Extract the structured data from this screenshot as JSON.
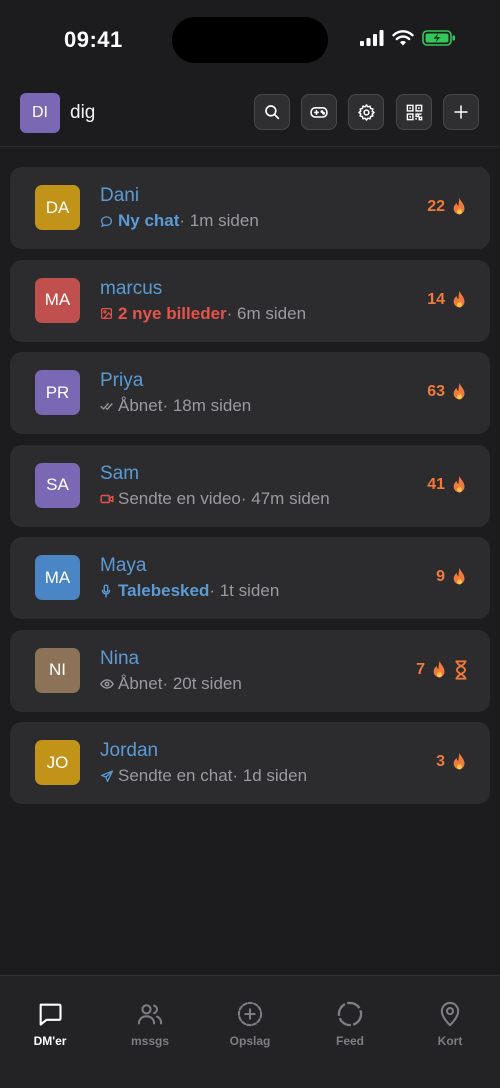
{
  "status_bar": {
    "time": "09:41"
  },
  "header": {
    "avatar_initials": "DI",
    "username": "dig",
    "buttons": [
      "search-icon",
      "gamepad-icon",
      "gear-icon",
      "qr-code-icon",
      "plus-icon"
    ]
  },
  "colors": {
    "name_blue": "#5b9bd5",
    "streak_orange": "#f07a3c",
    "unread_red": "#e5534b",
    "unread_blue": "#5b9bd5",
    "muted": "#9a9a9f"
  },
  "chats": [
    {
      "initials": "DA",
      "name": "Dani",
      "avatar_color": "#c19319",
      "status_icon": "chat-bubble-icon",
      "status_label": "Ny chat",
      "status_color": "#5b9bd5",
      "status_bold": true,
      "time": " · 1m siden",
      "streak": "22",
      "hourglass": false
    },
    {
      "initials": "MA",
      "name": "marcus",
      "avatar_color": "#c0504d",
      "status_icon": "image-icon",
      "status_label": "2 nye billeder",
      "status_color": "#e5534b",
      "status_bold": true,
      "time": " · 6m siden",
      "streak": "14",
      "hourglass": false
    },
    {
      "initials": "PR",
      "name": "Priya",
      "avatar_color": "#7b68b5",
      "status_icon": "double-check-icon",
      "status_label": "Åbnet",
      "status_color": "#9a9a9f",
      "status_bold": false,
      "time": " · 18m siden",
      "streak": "63",
      "hourglass": false
    },
    {
      "initials": "SA",
      "name": "Sam",
      "avatar_color": "#7b68b5",
      "status_icon": "video-icon",
      "status_label": "Sendte en video",
      "status_color": "#9a9a9f",
      "status_bold": false,
      "time": " · 47m siden",
      "streak": "41",
      "hourglass": false
    },
    {
      "initials": "MA",
      "name": "Maya",
      "avatar_color": "#4a86c5",
      "status_icon": "microphone-icon",
      "status_label": "Talebesked",
      "status_color": "#5b9bd5",
      "status_bold": true,
      "time": " · 1t siden",
      "streak": "9",
      "hourglass": false
    },
    {
      "initials": "NI",
      "name": "Nina",
      "avatar_color": "#8c7358",
      "status_icon": "eye-icon",
      "status_label": "Åbnet",
      "status_color": "#9a9a9f",
      "status_bold": false,
      "time": " · 20t siden",
      "streak": "7",
      "hourglass": true
    },
    {
      "initials": "JO",
      "name": "Jordan",
      "avatar_color": "#c19319",
      "status_icon": "send-arrow-icon",
      "status_label": "Sendte en chat",
      "status_color": "#9a9a9f",
      "status_bold": false,
      "time": " · 1d siden",
      "streak": "3",
      "hourglass": false
    }
  ],
  "tabs": [
    {
      "label": "DM'er",
      "icon": "chat-bubble-icon",
      "active": true
    },
    {
      "label": "mssgs",
      "icon": "users-icon",
      "active": false
    },
    {
      "label": "Opslag",
      "icon": "plus-circle-icon",
      "active": false
    },
    {
      "label": "Feed",
      "icon": "circle-icon",
      "active": false
    },
    {
      "label": "Kort",
      "icon": "map-pin-icon",
      "active": false
    }
  ]
}
